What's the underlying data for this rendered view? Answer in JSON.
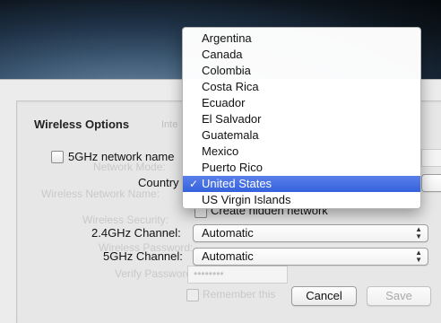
{
  "dialog": {
    "section_title": "Wireless Options",
    "tab_hint": "Inte",
    "checkbox_5ghz_label": "5GHz network name",
    "country_label": "Country",
    "channel_24_label": "2.4GHz Channel:",
    "channel_24_value": "Automatic",
    "channel_5_label": "5GHz Channel:",
    "channel_5_value": "Automatic",
    "cancel_label": "Cancel",
    "save_label": "Save"
  },
  "background_labels": {
    "network_mode": "Network Mode:",
    "wireless_network_name": "Wireless Network Name:",
    "wireless_security": "Wireless Security:",
    "wireless_password": "Wireless Password:",
    "verify_password": "Verify Password:",
    "password_dots": "••••••••",
    "create_hidden_network": "Create hidden network",
    "remember_this": "Remember this"
  },
  "country_menu": {
    "selected_index": 9,
    "items": [
      "Argentina",
      "Canada",
      "Colombia",
      "Costa Rica",
      "Ecuador",
      "El Salvador",
      "Guatemala",
      "Mexico",
      "Puerto Rico",
      "United States",
      "US Virgin Islands"
    ]
  },
  "colors": {
    "selection_blue": "#3562dd",
    "sheet_bg": "#ececec"
  }
}
